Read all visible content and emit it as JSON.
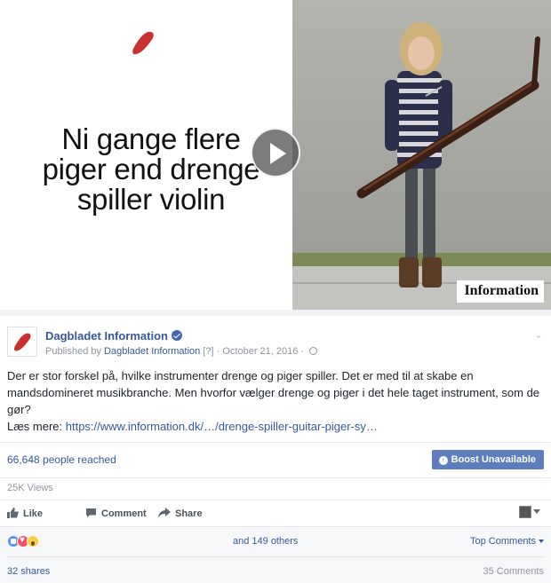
{
  "video": {
    "headline_lines": [
      "Ni gange flere",
      "piger end drenge",
      "spiller violin"
    ],
    "brand_watermark": "Information",
    "brand_color": "#c8312e"
  },
  "post": {
    "page_name": "Dagbladet Information",
    "published_by_prefix": "Published by ",
    "publisher": "Dagbladet Information",
    "publisher_marker": " [?]",
    "date_separator": " · ",
    "date": "October 21, 2016",
    "date_suffix": " · ",
    "text_lines": [
      "Der er stor forskel på, hvilke instrumenter drenge og piger spiller. Det er med til at skabe en",
      "mandsdomineret musikbranche. Men hvorfor vælger drenge og piger i det hele taget instrument, som de",
      "gør?"
    ],
    "read_more_prefix": "Læs mere: ",
    "read_more_link": "https://www.information.dk/…/drenge-spiller-guitar-piger-sy…"
  },
  "insights": {
    "reached": "66,648 people reached",
    "boost_label": "Boost Unavailable",
    "views": "25K Views"
  },
  "actions": {
    "like": "Like",
    "comment": "Comment",
    "share": "Share"
  },
  "feedback": {
    "others": "and 149 others",
    "top_comments": "Top Comments",
    "shares": "32 shares",
    "comments": "35 Comments"
  },
  "colors": {
    "link": "#365899",
    "boost_bg": "#4267b2",
    "like_blue": "#5890ff",
    "love_red": "#f25268",
    "wow_yellow": "#fbcd44"
  }
}
